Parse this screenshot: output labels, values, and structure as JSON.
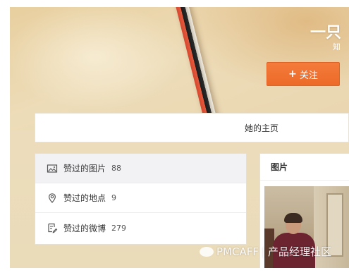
{
  "profile": {
    "name": "一只",
    "subtitle": "知",
    "follow_label": "关注",
    "follow_icon": "plus-icon"
  },
  "home_tab": {
    "label": "她的主页"
  },
  "sidebar": {
    "items": [
      {
        "icon": "image-icon",
        "label": "赞过的图片",
        "count": "88",
        "active": true
      },
      {
        "icon": "location-pin-icon",
        "label": "赞过的地点",
        "count": "9",
        "active": false
      },
      {
        "icon": "edit-note-icon",
        "label": "赞过的微博",
        "count": "279",
        "active": false
      }
    ]
  },
  "photos_panel": {
    "title": "图片"
  },
  "watermark": {
    "brand": "PMCAFF",
    "separator": "|",
    "text": "产品经理社区"
  },
  "colors": {
    "accent": "#EC6A2A",
    "cover_bg": "#EBDAB6",
    "active_row_bg": "#F2F2F5"
  }
}
